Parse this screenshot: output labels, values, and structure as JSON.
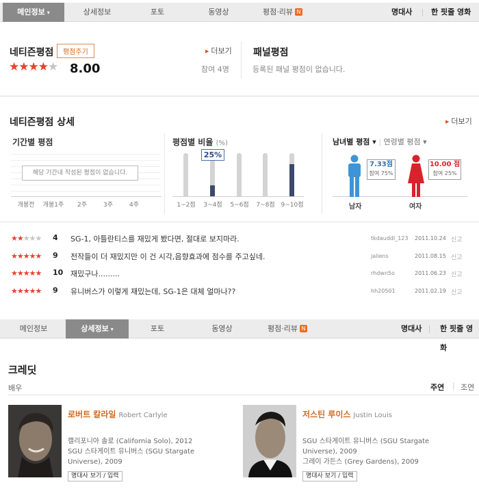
{
  "top_tabs": {
    "items": [
      {
        "label": "메인정보",
        "caret": "▾",
        "new": false,
        "active": true
      },
      {
        "label": "상세정보",
        "caret": "",
        "new": false,
        "active": false
      },
      {
        "label": "포토",
        "caret": "",
        "new": false,
        "active": false
      },
      {
        "label": "동영상",
        "caret": "",
        "new": false,
        "active": false
      },
      {
        "label": "평점·리뷰",
        "caret": "",
        "new": true,
        "active": false
      }
    ],
    "right": [
      "명대사",
      "한 핏줄 영화"
    ],
    "new_badge": "N"
  },
  "netizen": {
    "title": "네티즌평점",
    "rate_button": "평점주기",
    "stars_on": 4,
    "stars_total": 5,
    "score": "8.00",
    "more": "더보기",
    "participants": "참여 4명"
  },
  "panel": {
    "title": "패널평점",
    "empty": "등록된 패널 평점이 없습니다."
  },
  "detail": {
    "title": "네티즌평점 상세",
    "more": "더보기",
    "period": {
      "title": "기간별 평점",
      "empty": "해당 기간내 작성된 평점이 없습니다.",
      "labels": [
        "개봉전",
        "개봉1주",
        "2주",
        "3주",
        "4주"
      ]
    },
    "ratio": {
      "title": "평점별 비율",
      "unit": "(%)",
      "labels": [
        "1~2점",
        "3~4점",
        "5~6점",
        "7~8점",
        "9~10점"
      ],
      "values": [
        0,
        25,
        0,
        0,
        75
      ],
      "highlight": "25%"
    },
    "gender": {
      "tab_on": "남녀별 평점",
      "tab_off": "연령별 평점",
      "male": {
        "label": "남자",
        "score": "7.33점",
        "pct": "참여 75%"
      },
      "female": {
        "label": "여자",
        "score": "10.00 점",
        "pct": "참여 25%"
      },
      "colors": {
        "male": "#3d94d6",
        "female": "#d9232c"
      }
    }
  },
  "reviews": [
    {
      "stars": 2,
      "score": "4",
      "text": "SG-1, 아틀란티스를 재밌게 봤다면, 절대로 보지마라.",
      "user": "tkdauddl_123",
      "date": "2011.10.24",
      "report": "신고"
    },
    {
      "stars": 4.5,
      "score": "9",
      "text": "전작들이 더 재밌지만 이 건 시각,음향효과에 점수를 주고싶네.",
      "user": "jaliens",
      "date": "2011.08.15",
      "report": "신고"
    },
    {
      "stars": 5,
      "score": "10",
      "text": "재밌구나.........",
      "user": "rhdwn5o",
      "date": "2011.06.23",
      "report": "신고"
    },
    {
      "stars": 4.5,
      "score": "9",
      "text": "유니버스가 이렇게 재밌는데, SG-1은 대체 얼마나??",
      "user": "hh20501",
      "date": "2011.02.19",
      "report": "신고"
    }
  ],
  "bottom_tabs": {
    "items": [
      {
        "label": "메인정보",
        "caret": "",
        "new": false,
        "active": false
      },
      {
        "label": "상세정보",
        "caret": "▾",
        "new": false,
        "active": true
      },
      {
        "label": "포토",
        "caret": "",
        "new": false,
        "active": false
      },
      {
        "label": "동영상",
        "caret": "",
        "new": false,
        "active": false
      },
      {
        "label": "평점·리뷰",
        "caret": "",
        "new": true,
        "active": false
      }
    ],
    "right": [
      "명대사",
      "한 핏줄 영화"
    ]
  },
  "credits": {
    "title": "크레딧",
    "cast_label": "배우",
    "sort_on": "주연",
    "sort_off": "조연",
    "actors": [
      {
        "name": "로버트 칼라일",
        "name_en": "Robert Carlyle",
        "filmo": [
          "캘리포니아 솔로 (California Solo), 2012",
          "SGU 스타게이트 유니버스 (SGU Stargate",
          "Universe), 2009"
        ],
        "button": "명대사 보기 / 입력"
      },
      {
        "name": "저스틴 루이스",
        "name_en": "Justin Louis",
        "filmo": [
          "SGU 스타게이트 유니버스 (SGU Stargate",
          "Universe), 2009",
          "그레이 가든스 (Grey Gardens), 2009"
        ],
        "button": "명대사 보기 / 입력"
      }
    ]
  },
  "colors": {
    "accent": "#d2691e",
    "star": "#e8402c",
    "bar": "#3b4a6b"
  }
}
